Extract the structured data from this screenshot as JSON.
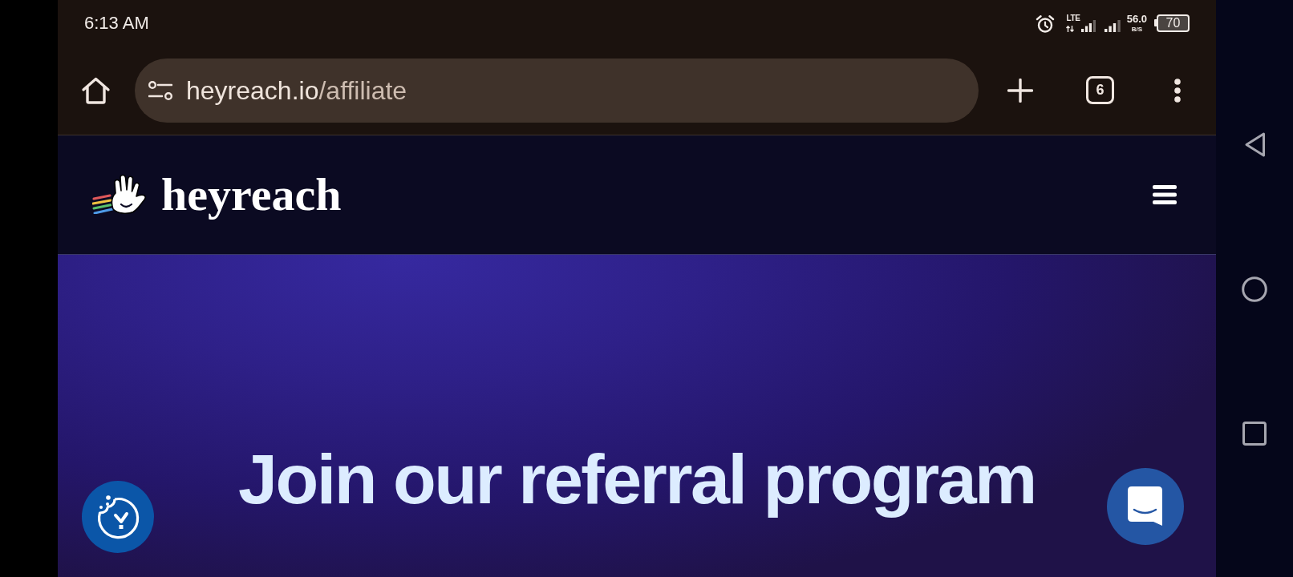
{
  "status_bar": {
    "time": "6:13 AM",
    "network": "LTE",
    "speed": "56.0",
    "speed_unit": "B/S",
    "battery": "70"
  },
  "browser": {
    "address": {
      "host": "heyreach.io",
      "path": "/affiliate"
    },
    "tab_count": "6"
  },
  "site_header": {
    "brand": "heyreach"
  },
  "hero": {
    "title": "Join our referral program"
  }
}
